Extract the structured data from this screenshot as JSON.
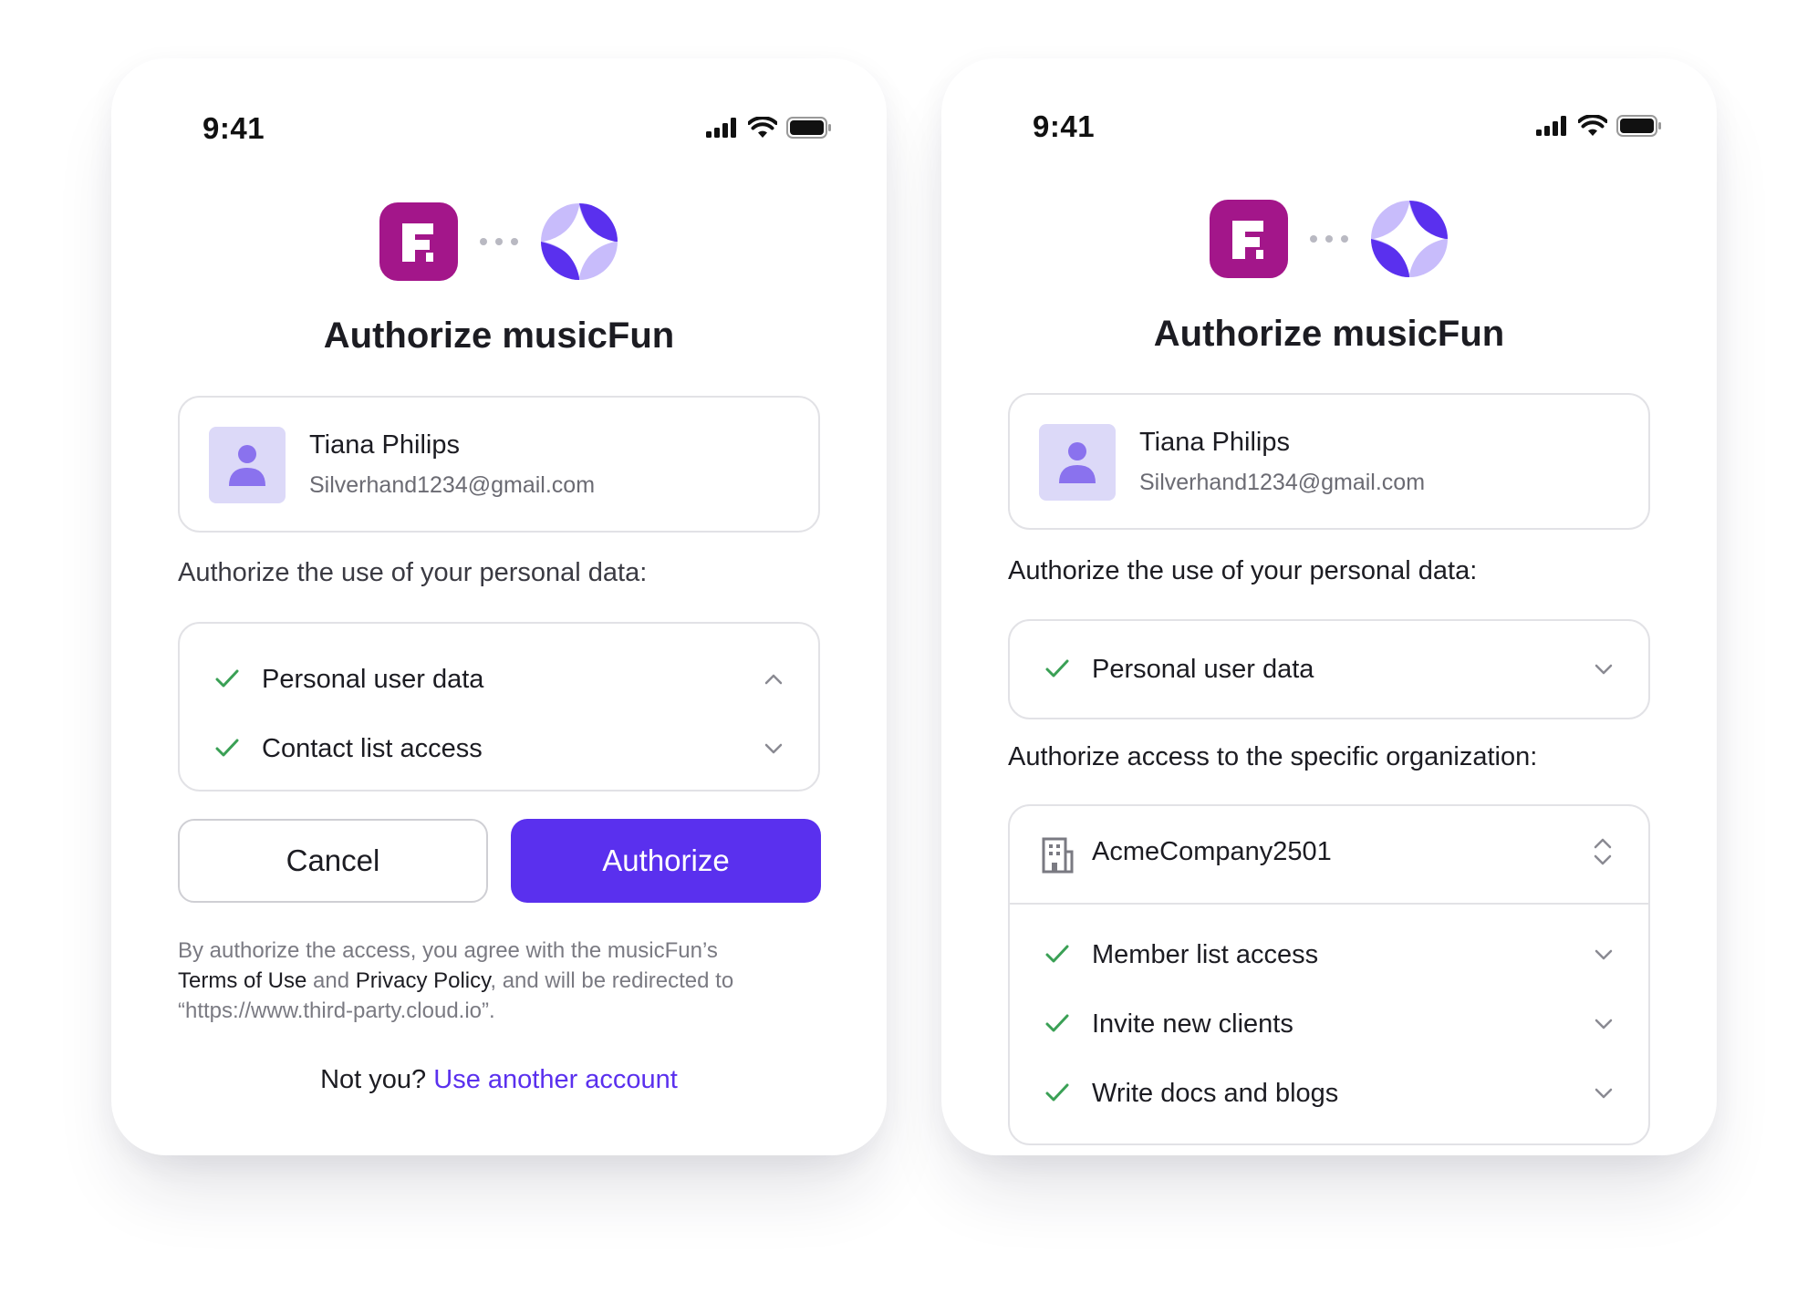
{
  "screens": [
    {
      "status_time": "9:41",
      "title": "Authorize musicFun",
      "account": {
        "name": "Tiana Philips",
        "email": "Silverhand1234@gmail.com"
      },
      "personal_data_label": "Authorize the use of your personal data:",
      "permissions": [
        {
          "label": "Personal user data",
          "expanded": true
        },
        {
          "label": "Contact list access",
          "expanded": false
        }
      ],
      "cancel_label": "Cancel",
      "authorize_label": "Authorize",
      "legal": {
        "part1": "By authorize the access, you agree with the musicFun’s",
        "terms": "Terms of Use",
        "and": "and",
        "privacy": "Privacy Policy",
        "part2": ", and will be redirected to",
        "url": "“https://www.third-party.cloud.io”."
      },
      "not_you": "Not you?",
      "use_another": "Use another account"
    },
    {
      "status_time": "9:41",
      "title": "Authorize musicFun",
      "account": {
        "name": "Tiana Philips",
        "email": "Silverhand1234@gmail.com"
      },
      "personal_data_label": "Authorize the use of your personal data:",
      "permissions": [
        {
          "label": "Personal user data",
          "expanded": false
        }
      ],
      "org_label": "Authorize access to the specific organization:",
      "organization": "AcmeCompany2501",
      "org_permissions": [
        {
          "label": "Member list access"
        },
        {
          "label": "Invite new clients"
        },
        {
          "label": "Write docs and blogs"
        }
      ]
    }
  ],
  "colors": {
    "brand_primary": "#5a30ee",
    "app_logo": "#a3168a",
    "check": "#3aa055",
    "avatar_bg": "#dcd9f8",
    "avatar_fg": "#8a72ee"
  },
  "icons": [
    "signal-icon",
    "wifi-icon",
    "battery-icon",
    "app-logo-icon",
    "sparkle-logo-icon",
    "user-avatar-icon",
    "check-icon",
    "chevron-up-icon",
    "chevron-down-icon",
    "building-icon",
    "chevron-updown-icon"
  ]
}
